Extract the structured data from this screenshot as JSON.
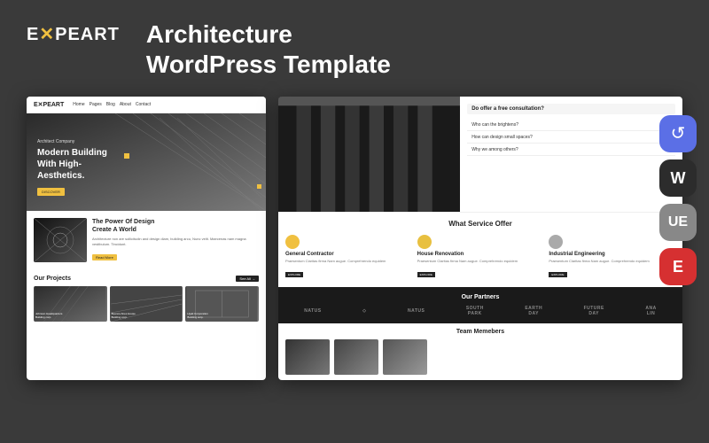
{
  "background_color": "#3a3a3a",
  "header": {
    "logo": "EXPEART",
    "logo_x": "X",
    "title_line1": "Architecture",
    "title_line2": "WordPress Template"
  },
  "left_preview": {
    "nav": {
      "logo": "EXPEART",
      "items": [
        "Home",
        "Pages",
        "Blog",
        "About",
        "Contact"
      ]
    },
    "hero": {
      "small_text": "Architect Company",
      "big_text": "Modern Building\nWith High-\nAesthetics.",
      "btn": "DISCOVER"
    },
    "section": {
      "title": "The Power Of Design\nCreate A World",
      "body": "Architecture non are sollicitudin and design diam, building arcu, Nunc velit. Maecenas nam magna vestibulum. Tincidunt.",
      "btn": "Read More"
    },
    "projects": {
      "title": "Our Projects",
      "link": "See All →",
      "items": [
        {
          "label": "Johnson Headquarters\nBuilding corp."
        },
        {
          "label": "Buenos Aires House\nBuilding corp."
        },
        {
          "label": "Hyatt Corporation\nBuilding corp."
        }
      ]
    }
  },
  "right_preview": {
    "faq": {
      "header": "Do offer a free consultation?",
      "items": [
        "Who can the brightens?",
        "How can design small spaces?",
        "Why we among others?"
      ]
    },
    "services": {
      "title": "What Service Offer",
      "items": [
        {
          "icon_color": "#f0c040",
          "name": "General Contractor",
          "desc": "Praesentum Claritas firma Nam augue. Comprehrendo...",
          "btn": "EXPLORE"
        },
        {
          "icon_color": "#e8c040",
          "name": "House Renovation",
          "desc": "Praesentum Claritas firma Nam augue. Comprehrendo...",
          "btn": "EXPLORE"
        },
        {
          "icon_color": "#888",
          "name": "Industrial Engineering",
          "desc": "Praesentum Claritas firma Nam augue. Comprehrendo...",
          "btn": "EXPLORE"
        }
      ]
    },
    "partners": {
      "title": "Our Partners",
      "logos": [
        "NATUS",
        "◇",
        "NATUS",
        "SOUTH\nPARK",
        "EARTH\nDAY",
        "FUTURE\nDAY",
        "ANA\nLIN"
      ]
    },
    "team": {
      "title": "Team Memebers"
    }
  },
  "icons_panel": {
    "items": [
      {
        "color": "#5b6fe6",
        "symbol": "↺",
        "name": "refresh-icon"
      },
      {
        "color": "#2c2c2c",
        "symbol": "W",
        "name": "wordpress-icon"
      },
      {
        "color": "#888888",
        "symbol": "≡",
        "name": "elementor-icon"
      },
      {
        "color": "#d63031",
        "symbol": "E",
        "name": "elementor2-icon"
      }
    ]
  }
}
